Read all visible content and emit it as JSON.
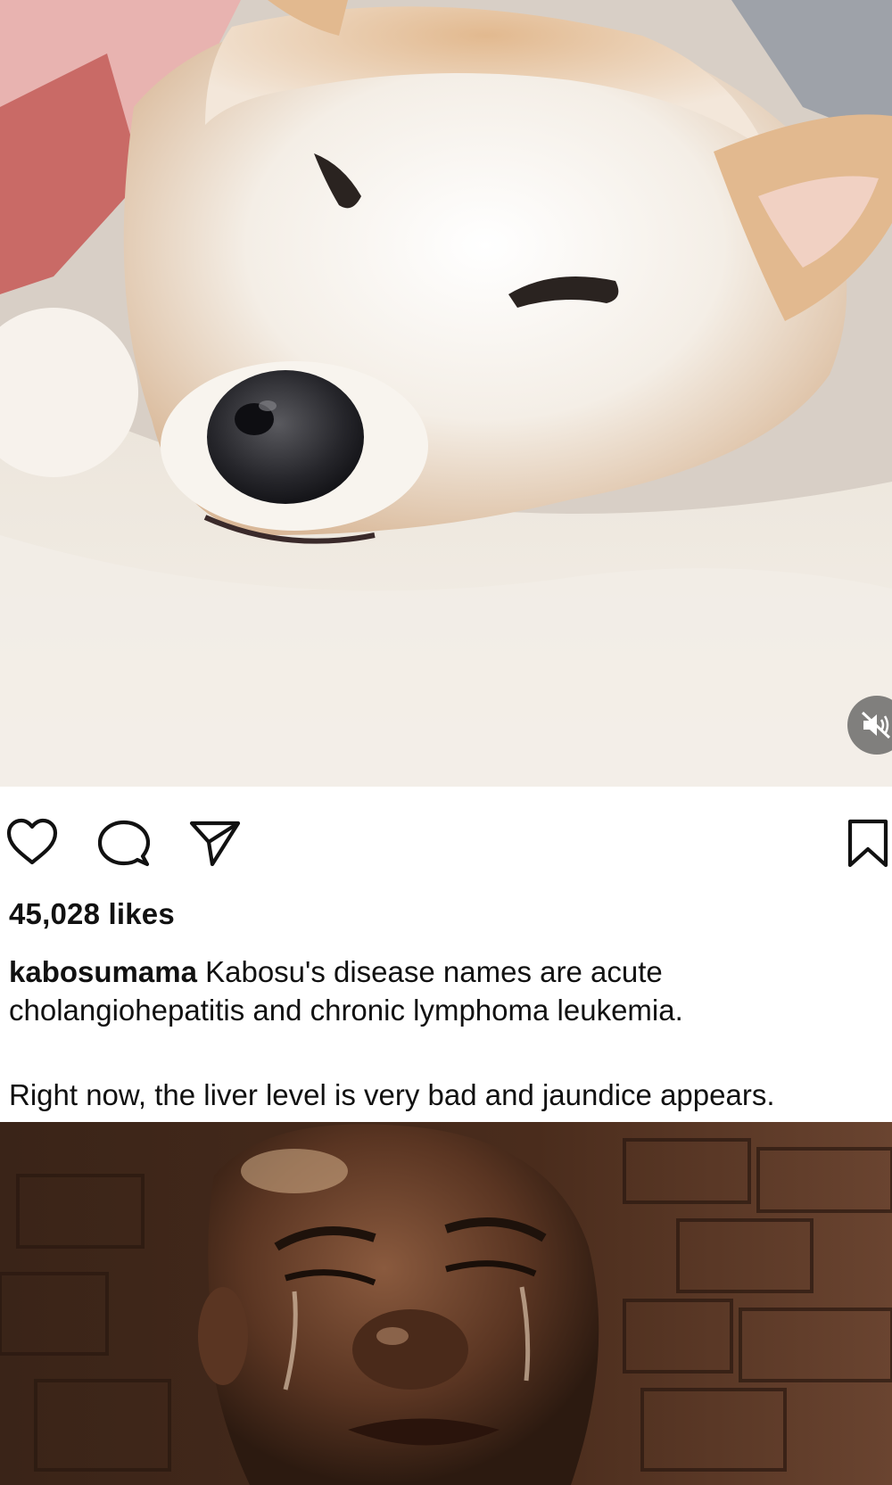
{
  "post": {
    "media_alt": "Sleeping Shiba Inu dog resting its head on a white fluffy blanket",
    "video_muted": true
  },
  "actions": {
    "like_icon": "heart-outline-icon",
    "comment_icon": "speech-bubble-icon",
    "share_icon": "paper-plane-icon",
    "save_icon": "bookmark-outline-icon"
  },
  "likes_text": "45,028 likes",
  "caption": {
    "username": "kabosumama",
    "text": " Kabosu's disease names are acute cholangiohepatitis and chronic lymphoma leukemia.",
    "text2": "Right now, the liver level is very bad and jaundice appears."
  },
  "meme": {
    "alt": "Close-up of a crying man with tears on his face, dark brick background"
  },
  "colors": {
    "text": "#111111",
    "background": "#ffffff",
    "mute_button_bg": "#5a5a5a"
  }
}
